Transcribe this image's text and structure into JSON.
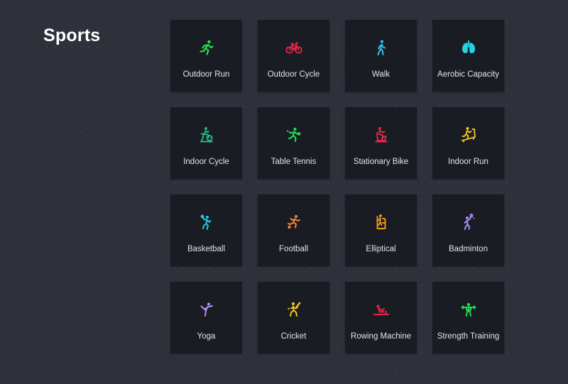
{
  "page": {
    "title": "Sports"
  },
  "sports": [
    {
      "label": "Outdoor Run",
      "icon": "outdoor-run-icon",
      "color": "#22dd55"
    },
    {
      "label": "Outdoor Cycle",
      "icon": "bicycle-icon",
      "color": "#e8264a"
    },
    {
      "label": "Walk",
      "icon": "walk-icon",
      "color": "#29c6e6"
    },
    {
      "label": "Aerobic Capacity",
      "icon": "lungs-icon",
      "color": "#22d3e0"
    },
    {
      "label": "Indoor Cycle",
      "icon": "indoor-cycle-icon",
      "color": "#1fc98a"
    },
    {
      "label": "Table Tennis",
      "icon": "table-tennis-icon",
      "color": "#22dd55"
    },
    {
      "label": "Stationary Bike",
      "icon": "stationary-bike-icon",
      "color": "#e8264a"
    },
    {
      "label": "Indoor Run",
      "icon": "treadmill-icon",
      "color": "#f2c21b"
    },
    {
      "label": "Basketball",
      "icon": "basketball-icon",
      "color": "#29c6e6"
    },
    {
      "label": "Football",
      "icon": "football-icon",
      "color": "#f5833a"
    },
    {
      "label": "Elliptical",
      "icon": "elliptical-icon",
      "color": "#f29d1a"
    },
    {
      "label": "Badminton",
      "icon": "badminton-icon",
      "color": "#a98cf5"
    },
    {
      "label": "Yoga",
      "icon": "yoga-icon",
      "color": "#b28cf5"
    },
    {
      "label": "Cricket",
      "icon": "cricket-icon",
      "color": "#f2c21b"
    },
    {
      "label": "Rowing Machine",
      "icon": "rowing-machine-icon",
      "color": "#e8264a"
    },
    {
      "label": "Strength Training",
      "icon": "strength-training-icon",
      "color": "#22dd55"
    }
  ]
}
